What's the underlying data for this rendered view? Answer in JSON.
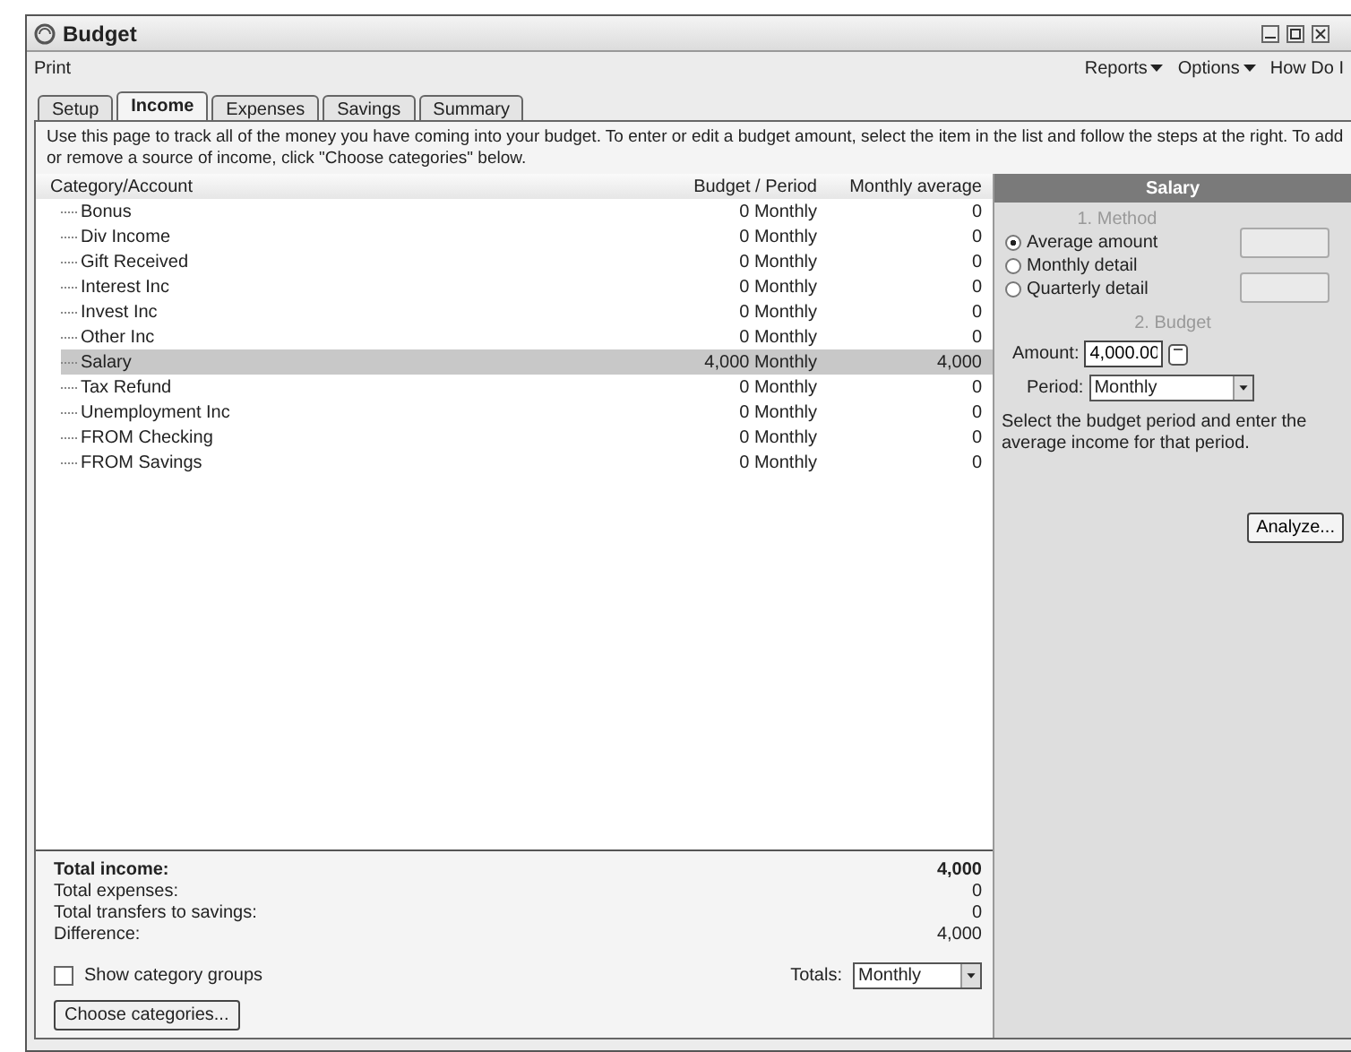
{
  "window": {
    "title": "Budget"
  },
  "menu": {
    "left": [
      "Print"
    ],
    "right": [
      {
        "label": "Reports",
        "dropdown": true
      },
      {
        "label": "Options",
        "dropdown": true
      },
      {
        "label": "How Do I",
        "dropdown": false
      }
    ]
  },
  "tabs": [
    {
      "label": "Setup",
      "selected": false
    },
    {
      "label": "Income",
      "selected": true
    },
    {
      "label": "Expenses",
      "selected": false
    },
    {
      "label": "Savings",
      "selected": false
    },
    {
      "label": "Summary",
      "selected": false
    }
  ],
  "description": "Use this page to track all of the money you have coming into your budget. To enter or edit a budget amount, select the item in the list and follow the steps at the right. To add or remove a source of income, click \"Choose categories\" below.",
  "table": {
    "columns": [
      "Category/Account",
      "Budget / Period",
      "Monthly average"
    ],
    "rows": [
      {
        "name": "Bonus",
        "budget": "0 Monthly",
        "average": "0",
        "selected": false
      },
      {
        "name": "Div Income",
        "budget": "0 Monthly",
        "average": "0",
        "selected": false
      },
      {
        "name": "Gift Received",
        "budget": "0 Monthly",
        "average": "0",
        "selected": false
      },
      {
        "name": "Interest Inc",
        "budget": "0 Monthly",
        "average": "0",
        "selected": false
      },
      {
        "name": "Invest Inc",
        "budget": "0 Monthly",
        "average": "0",
        "selected": false
      },
      {
        "name": "Other Inc",
        "budget": "0 Monthly",
        "average": "0",
        "selected": false
      },
      {
        "name": "Salary",
        "budget": "4,000 Monthly",
        "average": "4,000",
        "selected": true
      },
      {
        "name": "Tax Refund",
        "budget": "0 Monthly",
        "average": "0",
        "selected": false
      },
      {
        "name": "Unemployment Inc",
        "budget": "0 Monthly",
        "average": "0",
        "selected": false
      },
      {
        "name": "FROM Checking",
        "budget": "0 Monthly",
        "average": "0",
        "selected": false
      },
      {
        "name": "FROM Savings",
        "budget": "0 Monthly",
        "average": "0",
        "selected": false
      }
    ]
  },
  "totals": [
    {
      "label": "Total income:",
      "value": "4,000",
      "bold": true
    },
    {
      "label": "Total expenses:",
      "value": "0",
      "bold": false
    },
    {
      "label": "Total transfers to savings:",
      "value": "0",
      "bold": false
    },
    {
      "label": "Difference:",
      "value": "4,000",
      "bold": false
    }
  ],
  "show_category_groups": {
    "label": "Show category groups",
    "checked": false
  },
  "totals_select": {
    "label": "Totals:",
    "value": "Monthly"
  },
  "choose_button": "Choose categories...",
  "panel": {
    "title": "Salary",
    "method_title": "1. Method",
    "methods": [
      {
        "label": "Average amount",
        "selected": true
      },
      {
        "label": "Monthly detail",
        "selected": false
      },
      {
        "label": "Quarterly detail",
        "selected": false
      }
    ],
    "side_buttons": [
      {
        "disabled": true
      },
      {
        "disabled": true
      }
    ],
    "budget_title": "2. Budget",
    "amount_label": "Amount:",
    "amount": "4,000.00",
    "period_label": "Period:",
    "period": "Monthly",
    "hint": "Select the budget period and enter the average income for that period.",
    "analyze": "Analyze..."
  }
}
